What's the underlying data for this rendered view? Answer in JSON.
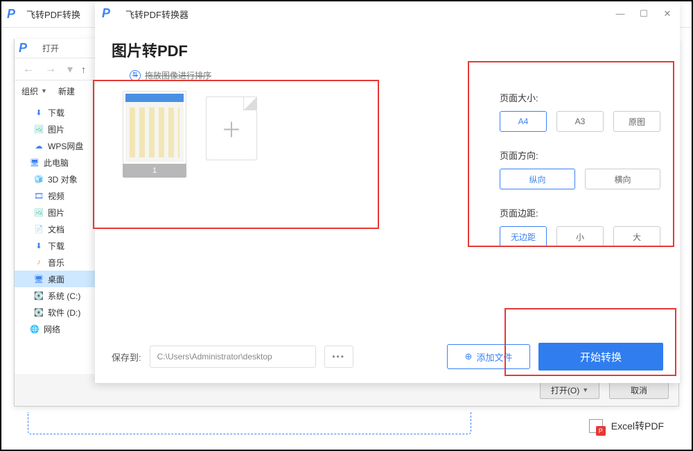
{
  "bg_app": {
    "title": "飞转PDF转换"
  },
  "file_dialog": {
    "title": "打开",
    "toolbar": {
      "organize": "组织",
      "new": "新建"
    },
    "sidebar": [
      {
        "icon": "download",
        "label": "下载"
      },
      {
        "icon": "picture",
        "label": "图片"
      },
      {
        "icon": "wps",
        "label": "WPS网盘"
      },
      {
        "icon": "pc",
        "label": "此电脑",
        "lvl": 1
      },
      {
        "icon": "cube",
        "label": "3D 对象"
      },
      {
        "icon": "video",
        "label": "视频"
      },
      {
        "icon": "picture",
        "label": "图片"
      },
      {
        "icon": "doc",
        "label": "文档"
      },
      {
        "icon": "download",
        "label": "下载"
      },
      {
        "icon": "music",
        "label": "音乐"
      },
      {
        "icon": "desktop",
        "label": "桌面",
        "active": true
      },
      {
        "icon": "disk",
        "label": "系统 (C:)"
      },
      {
        "icon": "disk",
        "label": "软件 (D:)"
      },
      {
        "icon": "net",
        "label": "网络",
        "lvl": 1
      }
    ],
    "footer": {
      "open": "打开(O)",
      "cancel": "取消"
    }
  },
  "converter": {
    "title": "飞转PDF转换器",
    "heading": "图片转PDF",
    "drop_hint": "拖放图像进行排序",
    "thumb_label": "1",
    "options": {
      "page_size": {
        "label": "页面大小:",
        "items": [
          "A4",
          "A3",
          "原图"
        ],
        "selected": 0
      },
      "orientation": {
        "label": "页面方向:",
        "items": [
          "纵向",
          "横向"
        ],
        "selected": 0
      },
      "margin": {
        "label": "页面边距:",
        "items": [
          "无边距",
          "小",
          "大"
        ],
        "selected": 0
      }
    },
    "save_label": "保存到:",
    "save_path": "C:\\Users\\Administrator\\desktop",
    "add_file": "添加文件",
    "start": "开始转换"
  },
  "excel_item": "Excel转PDF"
}
